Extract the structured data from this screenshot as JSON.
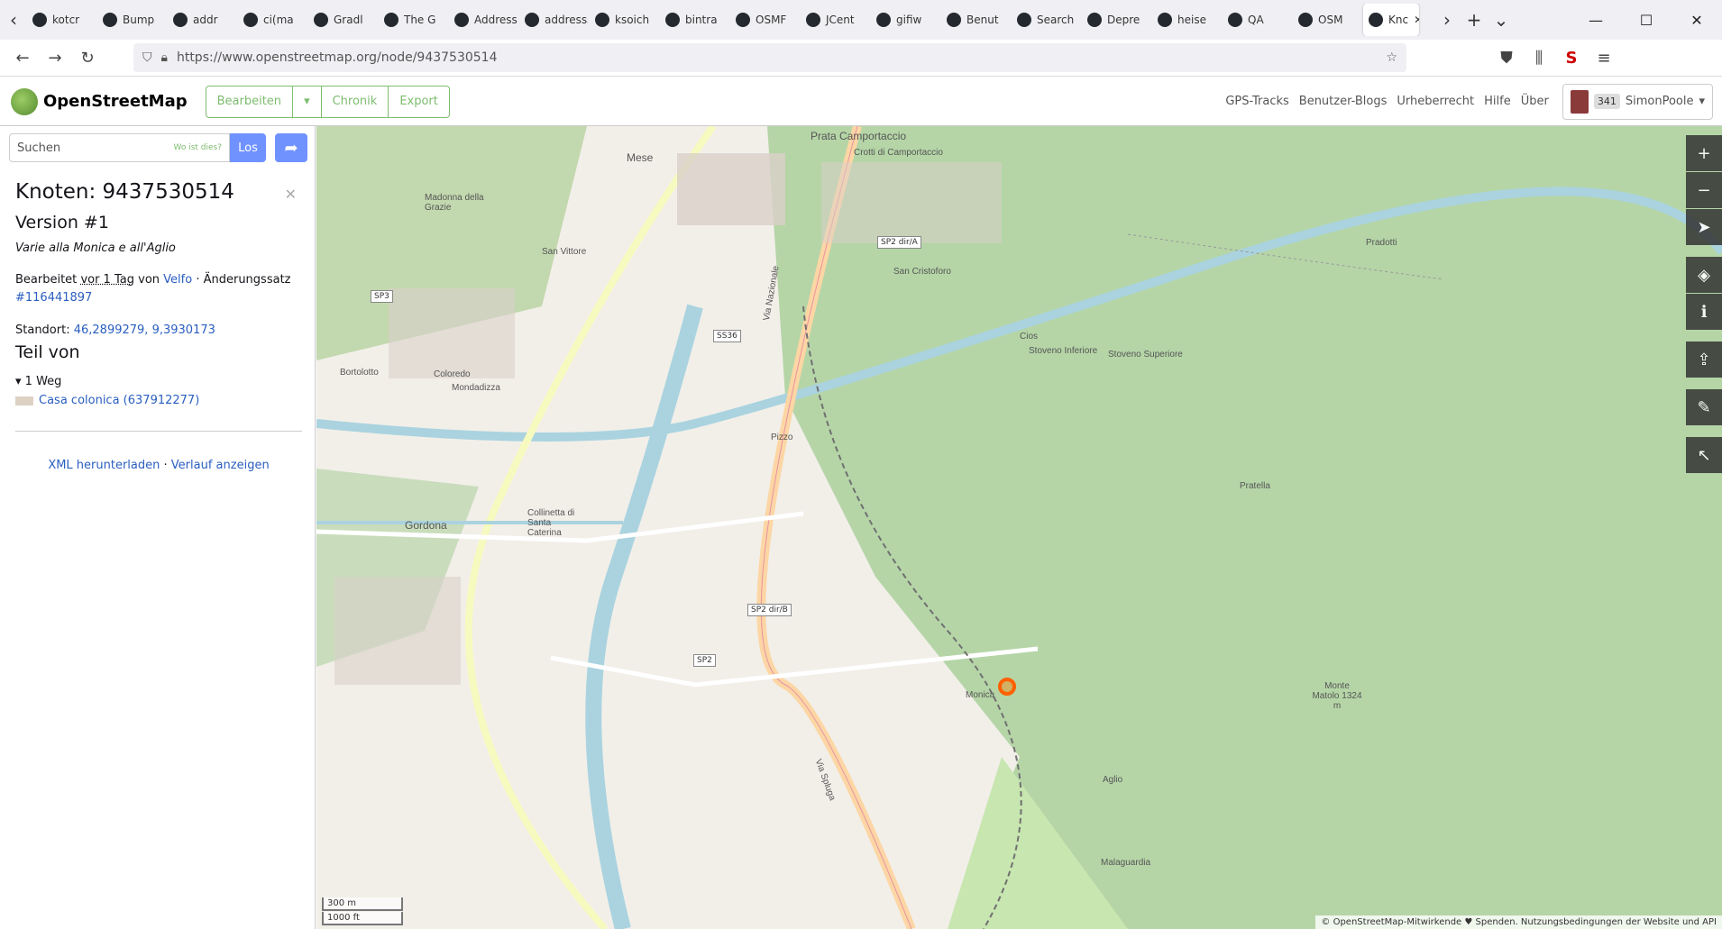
{
  "browser": {
    "tabs": [
      "kotcr",
      "Bump",
      "addr",
      "ci(ma",
      "Gradl",
      "The G",
      "Address C",
      "addresssta",
      "ksoich",
      "bintra",
      "OSMF",
      "JCent",
      "gifiw",
      "Benut",
      "Search",
      "Depre",
      "heise",
      "QA",
      "OSM",
      "Knc"
    ],
    "url": "https://www.openstreetmap.org/node/9437530514"
  },
  "header": {
    "brand": "OpenStreetMap",
    "edit": "Bearbeiten",
    "edit_arrow": "▾",
    "history": "Chronik",
    "export": "Export",
    "links": [
      "GPS-Tracks",
      "Benutzer-Blogs",
      "Urheberrecht",
      "Hilfe",
      "Über"
    ],
    "msg_count": "341",
    "username": "SimonPoole"
  },
  "search": {
    "placeholder": "Suchen",
    "where": "Wo ist dies?",
    "go": "Los"
  },
  "node": {
    "title": "Knoten: 9437530514",
    "version": "Version #1",
    "name": "Varie alla Monica e all'Aglio",
    "edited_prefix": "Bearbeitet",
    "edited_time": "vor 1 Tag",
    "edited_by": "von",
    "editor": "Velfo",
    "changeset_label": "· Änderungssatz",
    "changeset": "#116441897",
    "location_label": "Standort:",
    "location": "46,2899279, 9,3930173",
    "part_of": "Teil von",
    "ways_count": "1 Weg",
    "way": "Casa colonica (637912277)",
    "xml": "XML herunterladen",
    "history": "Verlauf anzeigen"
  },
  "map": {
    "labels": [
      "Prata Camportaccio",
      "Crotti di Camportaccio",
      "Mese",
      "Madonna della Grazie",
      "San Vittore",
      "Mondadizza",
      "Coloredo",
      "Bortolotto",
      "Gordona",
      "Collinetta di Santa Caterina",
      "Pizzo",
      "San Cristoforo",
      "Cios",
      "Stoveno Inferiore",
      "Stoveno Superiore",
      "Pratella",
      "Pradotti",
      "Monica",
      "Aglio",
      "Malaguardia",
      "Monte Matolo 1324 m"
    ],
    "roads": [
      "SP2 dir/A",
      "SS36",
      "SP3",
      "SP2 dir/B",
      "SP2",
      "Via Nazionale",
      "Via Spluga"
    ],
    "scale": [
      "300 m",
      "1000 ft"
    ],
    "attribution": "© OpenStreetMap-Mitwirkende ♥ Spenden. Nutzungsbedingungen der Website und API"
  }
}
